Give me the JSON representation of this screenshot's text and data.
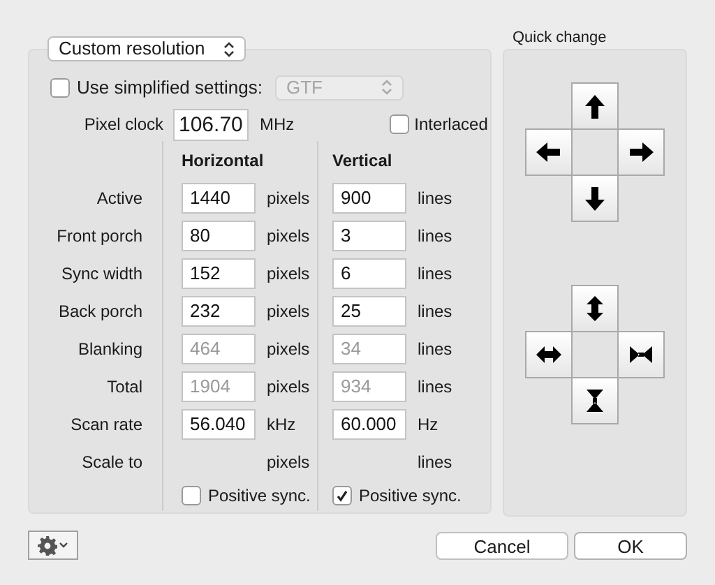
{
  "mode_dropdown": {
    "value": "Custom resolution"
  },
  "simplified": {
    "label": "Use simplified settings:",
    "checked": false,
    "dropdown": {
      "value": "GTF",
      "disabled": true
    }
  },
  "pixel_clock": {
    "label": "Pixel clock",
    "value": "106.70",
    "unit": "MHz"
  },
  "interlaced": {
    "label": "Interlaced",
    "checked": false
  },
  "columns": [
    "Horizontal",
    "Vertical"
  ],
  "rows": [
    {
      "label": "Active",
      "h": {
        "value": "1440",
        "disabled": false
      },
      "h_unit": "pixels",
      "v": {
        "value": "900",
        "disabled": false
      },
      "v_unit": "lines"
    },
    {
      "label": "Front porch",
      "h": {
        "value": "80",
        "disabled": false
      },
      "h_unit": "pixels",
      "v": {
        "value": "3",
        "disabled": false
      },
      "v_unit": "lines"
    },
    {
      "label": "Sync width",
      "h": {
        "value": "152",
        "disabled": false
      },
      "h_unit": "pixels",
      "v": {
        "value": "6",
        "disabled": false
      },
      "v_unit": "lines"
    },
    {
      "label": "Back porch",
      "h": {
        "value": "232",
        "disabled": false
      },
      "h_unit": "pixels",
      "v": {
        "value": "25",
        "disabled": false
      },
      "v_unit": "lines"
    },
    {
      "label": "Blanking",
      "h": {
        "value": "464",
        "disabled": true
      },
      "h_unit": "pixels",
      "v": {
        "value": "34",
        "disabled": true
      },
      "v_unit": "lines"
    },
    {
      "label": "Total",
      "h": {
        "value": "1904",
        "disabled": true
      },
      "h_unit": "pixels",
      "v": {
        "value": "934",
        "disabled": true
      },
      "v_unit": "lines"
    },
    {
      "label": "Scan rate",
      "h": {
        "value": "56.040",
        "disabled": false
      },
      "h_unit": "kHz",
      "v": {
        "value": "60.000",
        "disabled": false
      },
      "v_unit": "Hz"
    },
    {
      "label": "Scale to",
      "h_unit": "pixels",
      "v_unit": "lines"
    }
  ],
  "sync": [
    {
      "label": "Positive sync.",
      "checked": false
    },
    {
      "label": "Positive sync.",
      "checked": true
    }
  ],
  "quick_change": {
    "title": "Quick change"
  },
  "buttons": [
    {
      "label": "Cancel",
      "kind": "normal"
    },
    {
      "label": "OK",
      "kind": "default"
    }
  ]
}
